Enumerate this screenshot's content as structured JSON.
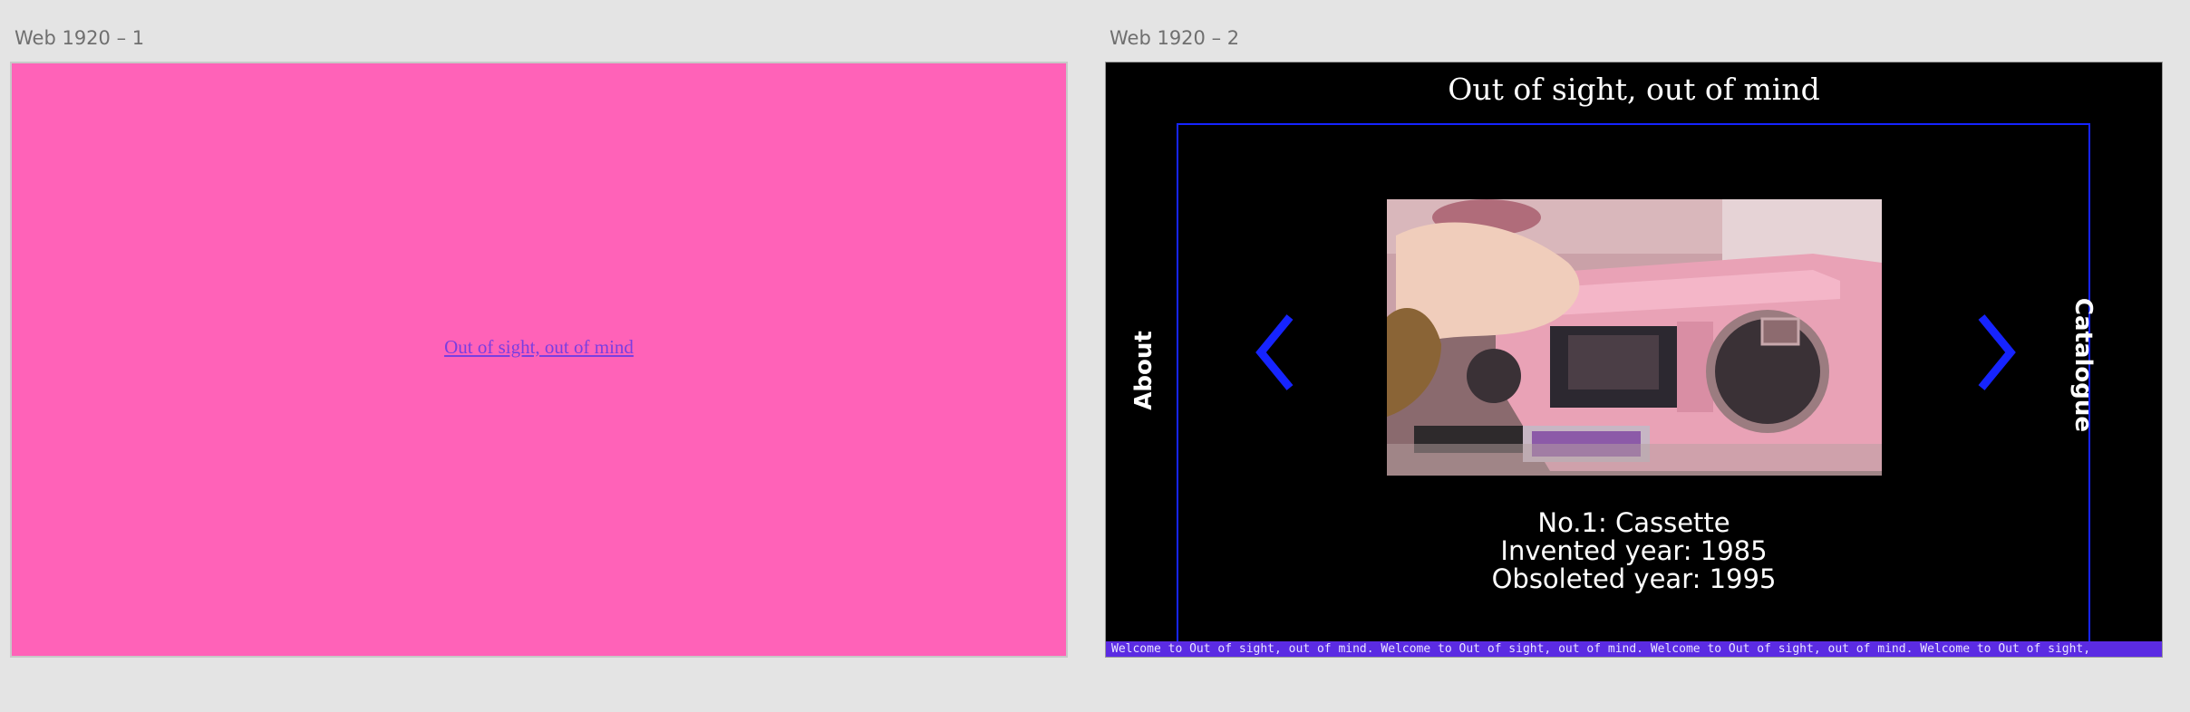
{
  "canvas": {
    "frame1_label": "Web 1920 – 1",
    "frame2_label": "Web 1920 – 2"
  },
  "frame1": {
    "link_text": "Out of sight, out of mind",
    "background": "#ff62b8"
  },
  "frame2": {
    "title": "Out of sight, out of mind",
    "nav_left_label": "About",
    "nav_right_label": "Catalogue",
    "caption": {
      "line1": "No.1: Cassette",
      "line2": "Invented year: 1985",
      "line3": "Obsoleted year: 1995"
    },
    "ticker_text": "Welcome to Out of sight, out of mind. Welcome to Out of sight, out of mind. Welcome to Out of sight, out of mind. Welcome to Out of sight,",
    "colors": {
      "background": "#000000",
      "accent_blue": "#1624ff",
      "ticker_bg": "#5b2be3"
    },
    "icons": {
      "prev": "chevron-left-icon",
      "next": "chevron-right-icon"
    }
  }
}
